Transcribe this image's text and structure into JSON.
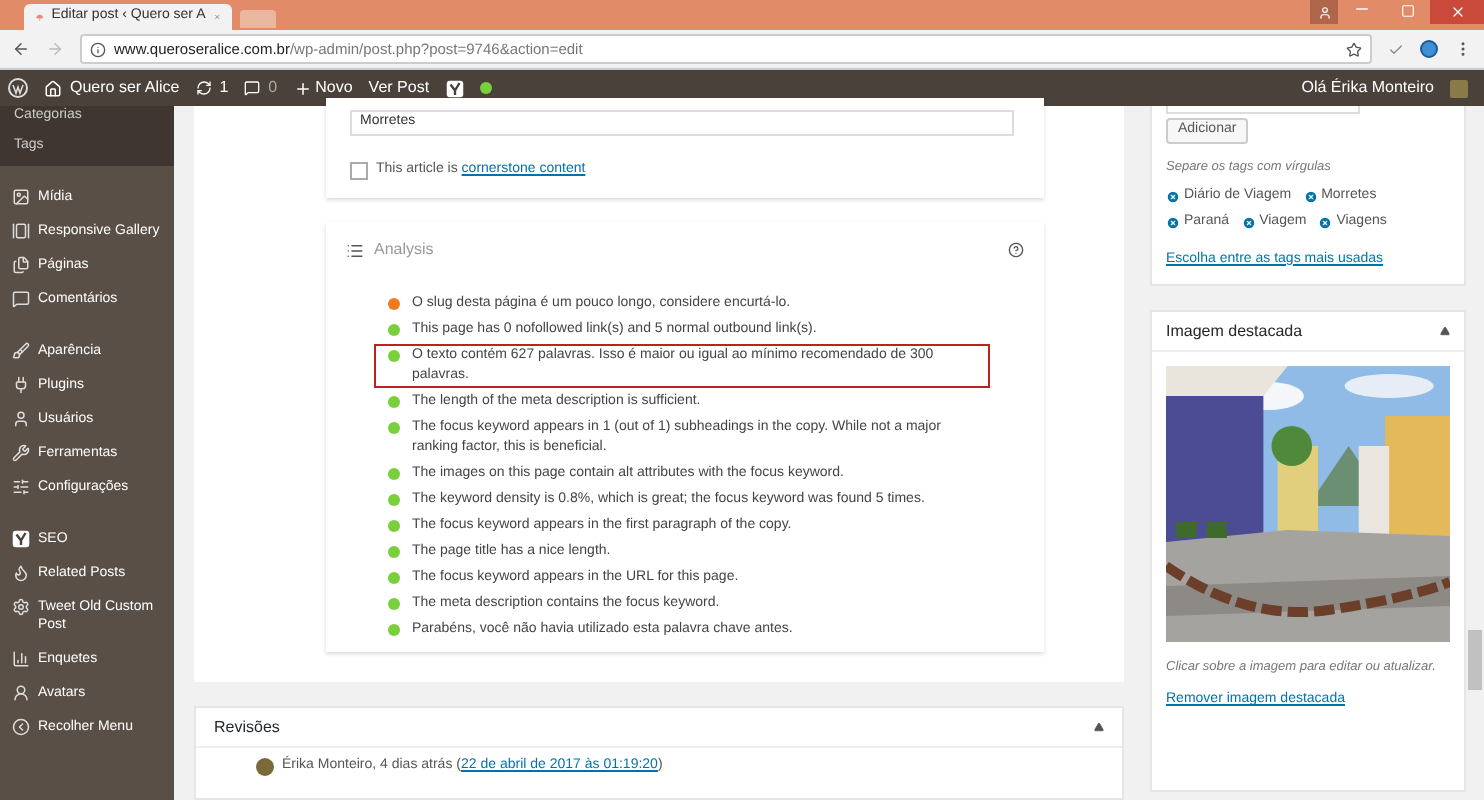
{
  "browser": {
    "tab_title": "Editar post ‹ Quero ser A",
    "url_host": "www.queroseralice.com.br",
    "url_path": "/wp-admin/post.php?post=9746&action=edit"
  },
  "admin_bar": {
    "site": "Quero ser Alice",
    "updates": "1",
    "comments": "0",
    "new": "Novo",
    "view": "Ver Post",
    "greeting": "Olá Érika Monteiro"
  },
  "sidebar": {
    "submenu": [
      "Categorias",
      "Tags"
    ],
    "groups": [
      {
        "items": [
          "Mídia",
          "Responsive Gallery",
          "Páginas",
          "Comentários"
        ]
      },
      {
        "items": [
          "Aparência",
          "Plugins",
          "Usuários",
          "Ferramentas",
          "Configurações"
        ]
      },
      {
        "items": [
          "SEO",
          "Related Posts",
          "Tweet Old Custom Post",
          "Enquetes",
          "Avatars",
          "Recolher Menu"
        ]
      }
    ]
  },
  "keyword_field": {
    "value": "Morretes"
  },
  "cornerstone": {
    "checked": false,
    "label": "This article is ",
    "link": "cornerstone content"
  },
  "analysis": {
    "title": "Analysis",
    "items": [
      {
        "text": "O slug desta página é um pouco longo, considere encurtá-lo.",
        "color": "#ee7c1b",
        "highlighted": false
      },
      {
        "text": "This page has 0 nofollowed link(s) and 5 normal outbound link(s).",
        "color": "#7ad03a",
        "highlighted": false
      },
      {
        "text": "O texto contém 627 palavras. Isso é maior ou igual ao mínimo recomendado de 300 palavras.",
        "color": "#7ad03a",
        "highlighted": true
      },
      {
        "text": "The length of the meta description is sufficient.",
        "color": "#7ad03a",
        "highlighted": false
      },
      {
        "text": "The focus keyword appears in 1 (out of 1) subheadings in the copy. While not a major ranking factor, this is beneficial.",
        "color": "#7ad03a",
        "highlighted": false
      },
      {
        "text": "The images on this page contain alt attributes with the focus keyword.",
        "color": "#7ad03a",
        "highlighted": false
      },
      {
        "text": "The keyword density is 0.8%, which is great; the focus keyword was found 5 times.",
        "color": "#7ad03a",
        "highlighted": false
      },
      {
        "text": "The focus keyword appears in the first paragraph of the copy.",
        "color": "#7ad03a",
        "highlighted": false
      },
      {
        "text": "The page title has a nice length.",
        "color": "#7ad03a",
        "highlighted": false
      },
      {
        "text": "The focus keyword appears in the URL for this page.",
        "color": "#7ad03a",
        "highlighted": false
      },
      {
        "text": "The meta description contains the focus keyword.",
        "color": "#7ad03a",
        "highlighted": false
      },
      {
        "text": "Parabéns, você não havia utilizado esta palavra chave antes.",
        "color": "#7ad03a",
        "highlighted": false
      }
    ]
  },
  "revisions": {
    "title": "Revisões",
    "entry": "Érika Monteiro, 4 dias atrás (",
    "date_link": "22 de abril de 2017 às 01:19:20",
    "entry_end": ")"
  },
  "tags_box": {
    "add_button": "Adicionar",
    "hint": "Separe os tags com vírgulas",
    "tags": [
      "Diário de Viagem",
      "Morretes",
      "Paraná",
      "Viagem",
      "Viagens"
    ],
    "link": "Escolha entre as tags mais usadas"
  },
  "featured_image": {
    "title": "Imagem destacada",
    "caption": "Clicar sobre a imagem para editar ou atualizar.",
    "remove_link": "Remover imagem destacada"
  }
}
